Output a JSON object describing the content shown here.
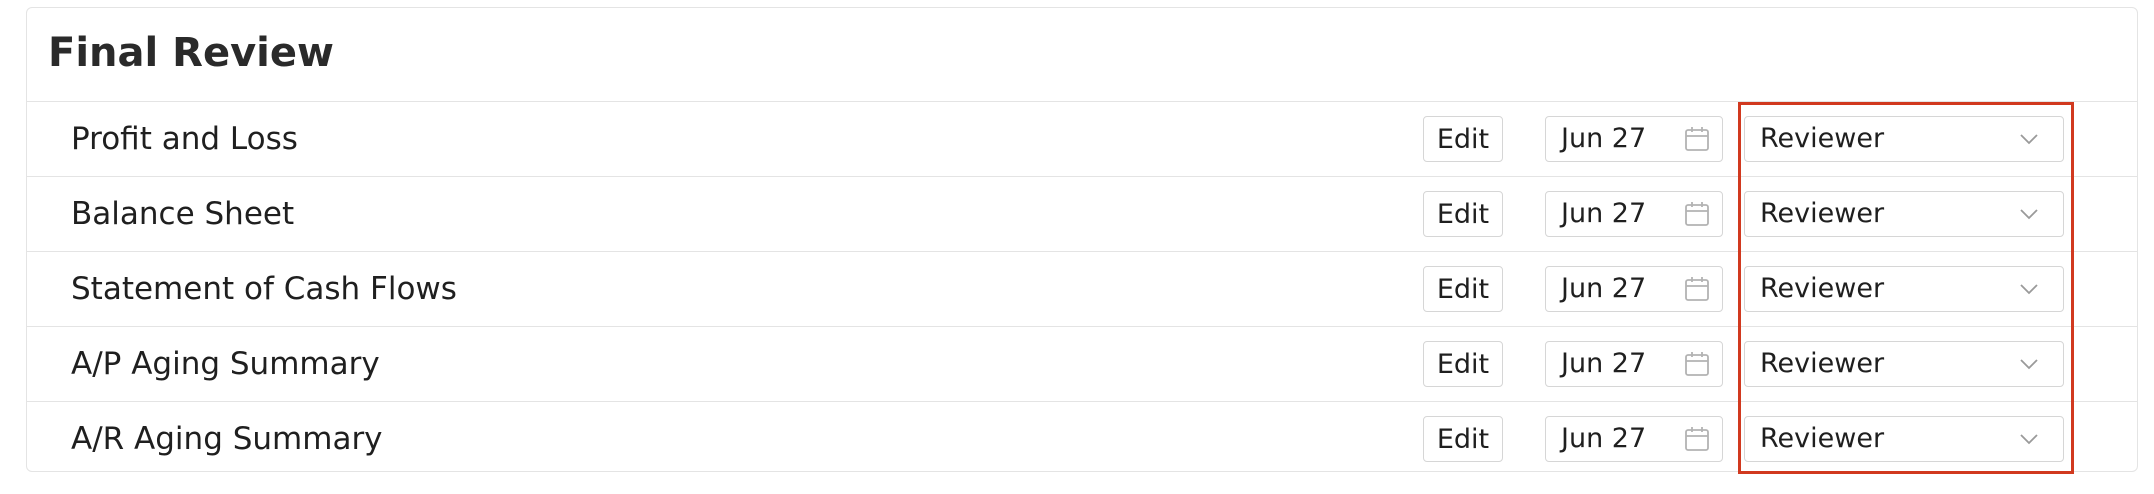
{
  "section": {
    "title": "Final Review"
  },
  "rows": [
    {
      "label": "Profit and Loss",
      "edit_label": "Edit",
      "date": "Jun 27",
      "reviewer": "Reviewer"
    },
    {
      "label": "Balance Sheet",
      "edit_label": "Edit",
      "date": "Jun 27",
      "reviewer": "Reviewer"
    },
    {
      "label": "Statement of Cash Flows",
      "edit_label": "Edit",
      "date": "Jun 27",
      "reviewer": "Reviewer"
    },
    {
      "label": "A/P Aging Summary",
      "edit_label": "Edit",
      "date": "Jun 27",
      "reviewer": "Reviewer"
    },
    {
      "label": "A/R Aging Summary",
      "edit_label": "Edit",
      "date": "Jun 27",
      "reviewer": "Reviewer"
    }
  ],
  "icons": {
    "date": "calendar-icon",
    "select": "chevron-down-icon"
  },
  "colors": {
    "highlight": "#d1391f",
    "border": "#e4e4e4",
    "text": "#1f1f1f"
  }
}
